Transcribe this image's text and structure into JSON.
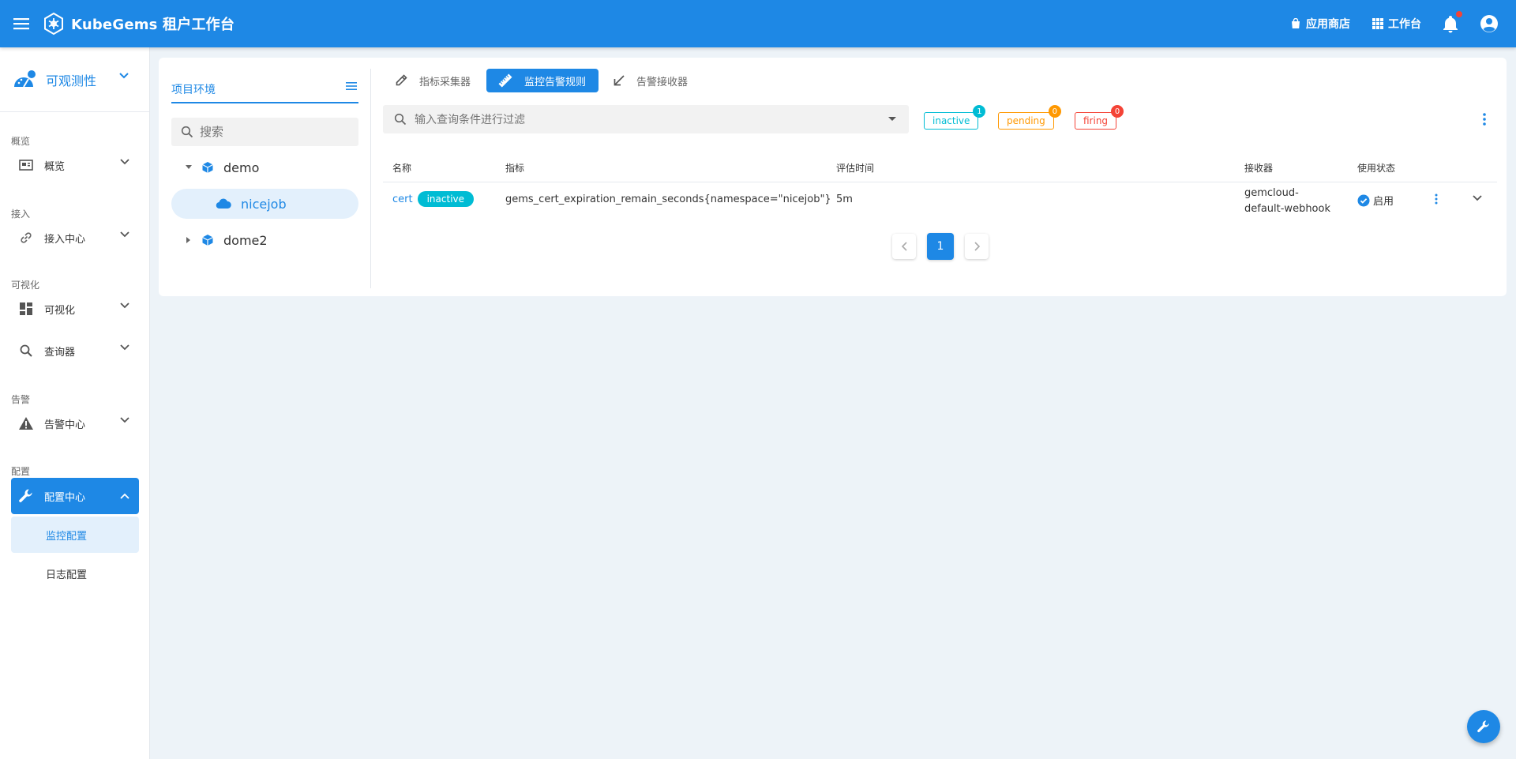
{
  "header": {
    "brand": "KubeGems 租户工作台",
    "app_store": "应用商店",
    "workspace": "工作台"
  },
  "sidebar": {
    "project_select": "可观测性",
    "sections": {
      "overview": "概览",
      "access": "接入",
      "visual": "可视化",
      "alert": "告警",
      "config": "配置"
    },
    "items": {
      "overview": "概览",
      "access_center": "接入中心",
      "visualize": "可视化",
      "query": "查询器",
      "alert_center": "告警中心",
      "config_center": "配置中心"
    },
    "sub_items": {
      "monitor_config": "监控配置",
      "log_config": "日志配置"
    }
  },
  "tree": {
    "title": "项目环境",
    "search_placeholder": "搜索",
    "nodes": {
      "demo": "demo",
      "nicejob": "nicejob",
      "dome2": "dome2"
    }
  },
  "tabs": {
    "collector": "指标采集器",
    "rules": "监控告警规则",
    "receiver": "告警接收器"
  },
  "filter": {
    "placeholder": "输入查询条件进行过滤"
  },
  "states": {
    "inactive": {
      "label": "inactive",
      "count": "1",
      "color": "#00bcd4"
    },
    "pending": {
      "label": "pending",
      "count": "0",
      "color": "#ff9800"
    },
    "firing": {
      "label": "firing",
      "count": "0",
      "color": "#f44336"
    }
  },
  "table": {
    "headers": {
      "name": "名称",
      "metric": "指标",
      "eval_time": "评估时间",
      "receiver": "接收器",
      "status": "使用状态"
    },
    "rows": [
      {
        "name": "cert",
        "state": "inactive",
        "metric": "gems_cert_expiration_remain_seconds{namespace=\"nicejob\"}",
        "eval_time": "5m",
        "receiver_line1": "gemcloud-",
        "receiver_line2": "default-webhook",
        "status": "启用"
      }
    ]
  },
  "pagination": {
    "current_page": "1"
  },
  "colors": {
    "primary": "#1e88e5",
    "background": "#edf3f8"
  }
}
